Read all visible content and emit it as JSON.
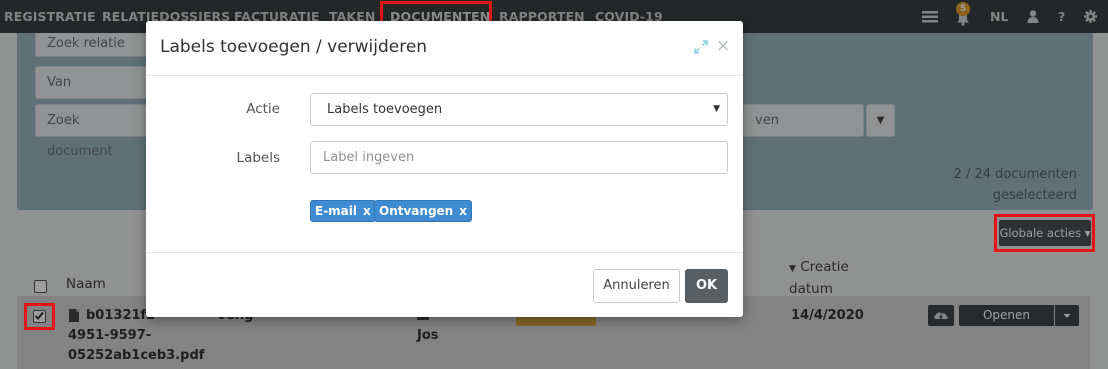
{
  "nav": {
    "items": [
      "REGISTRATIE",
      "RELATIEDOSSIERS",
      "FACTURATIE",
      "TAKEN",
      "DOCUMENTEN",
      "RAPPORTEN",
      "COVID-19"
    ],
    "active": "DOCUMENTEN",
    "notification_count": "5",
    "language": "NL"
  },
  "filters": {
    "zoek_relatie_placeholder": "Zoek relatie",
    "van_label": "Van",
    "zoek_document_placeholder": "Zoek document",
    "hidden_select_text": "ven",
    "selected_count_line1": "2 / 24 documenten",
    "selected_count_line2": "geselecteerd"
  },
  "toolbar": {
    "global_actions_label": "Globale acties"
  },
  "table": {
    "headers": {
      "naam": "Naam",
      "creatie_datum_line1": "Creatie",
      "creatie_datum_line2": "datum"
    },
    "row": {
      "filename_line1": "b01321f2-",
      "filename_line2": "4951-9597-",
      "filename_line3": "05252ab1ceb3.pdf",
      "col2": "0eng",
      "col3_line1": "Jos",
      "creatie_datum": "14/4/2020",
      "open_label": "Openen"
    }
  },
  "modal": {
    "title": "Labels toevoegen / verwijderen",
    "actie_label": "Actie",
    "actie_value": "Labels toevoegen",
    "labels_label": "Labels",
    "labels_placeholder": "Label ingeven",
    "tags": [
      "E-mail",
      "Ontvangen"
    ],
    "tag_remove": "x",
    "cancel_label": "Annuleren",
    "ok_label": "OK"
  },
  "colors": {
    "nav_bg": "#3b3f42",
    "filter_panel": "#9ab7c0",
    "tag_blue": "#3f8cd3",
    "ok_button": "#595e62",
    "highlight_red": "#e4141b"
  }
}
